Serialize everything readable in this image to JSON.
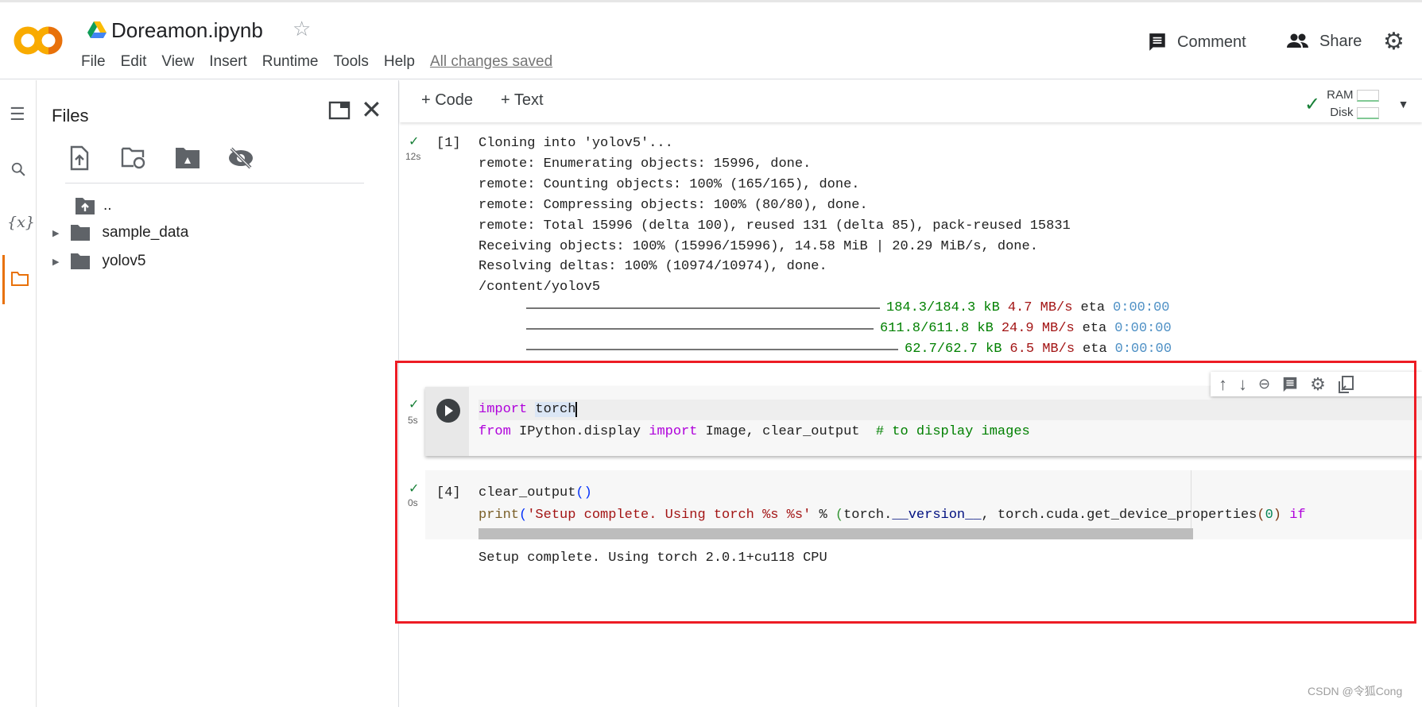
{
  "header": {
    "title": "Doreamon.ipynb",
    "menu": [
      "File",
      "Edit",
      "View",
      "Insert",
      "Runtime",
      "Tools",
      "Help"
    ],
    "saved": "All changes saved",
    "comment": "Comment",
    "share": "Share"
  },
  "toolbar": {
    "code": "+ Code",
    "text": "+ Text",
    "ram": "RAM",
    "disk": "Disk"
  },
  "files": {
    "title": "Files",
    "items": [
      {
        "name": "..",
        "type": "parent"
      },
      {
        "name": "sample_data",
        "type": "folder"
      },
      {
        "name": "yolov5",
        "type": "folder"
      }
    ]
  },
  "cells": [
    {
      "exec": "[1]",
      "time": "12s",
      "status": "success",
      "output": [
        "Cloning into 'yolov5'...",
        "remote: Enumerating objects: 15996, done.",
        "remote: Counting objects: 100% (165/165), done.",
        "remote: Compressing objects: 100% (80/80), done.",
        "remote: Total 15996 (delta 100), reused 131 (delta 85), pack-reused 15831",
        "Receiving objects: 100% (15996/15996), 14.58 MiB | 20.29 MiB/s, done.",
        "Resolving deltas: 100% (10974/10974), done.",
        "/content/yolov5"
      ],
      "progress": [
        {
          "size": "184.3/184.3 kB",
          "speed": "4.7 MB/s",
          "eta_label": "eta",
          "eta": "0:00:00"
        },
        {
          "size": "611.8/611.8 kB",
          "speed": "24.9 MB/s",
          "eta_label": "eta",
          "eta": "0:00:00"
        },
        {
          "size": "62.7/62.7 kB",
          "speed": "6.5 MB/s",
          "eta_label": "eta",
          "eta": "0:00:00"
        }
      ]
    },
    {
      "exec": "",
      "time": "5s",
      "status": "success",
      "code": [
        [
          {
            "t": "import",
            "c": "#af00db"
          },
          {
            "t": " "
          },
          {
            "t": "torch",
            "c": "#212121",
            "hl": true
          }
        ],
        [
          {
            "t": "from",
            "c": "#af00db"
          },
          {
            "t": " IPython.display "
          },
          {
            "t": "import",
            "c": "#af00db"
          },
          {
            "t": " Image, clear_output  "
          },
          {
            "t": "# to display images",
            "c": "#008000"
          }
        ]
      ]
    },
    {
      "exec": "[4]",
      "time": "0s",
      "status": "success",
      "code": [
        [
          {
            "t": "clear_output"
          },
          {
            "t": "()",
            "c": "#0431fa"
          }
        ],
        [
          {
            "t": "print",
            "c": "#795e26"
          },
          {
            "t": "(",
            "c": "#0431fa"
          },
          {
            "t": "'Setup complete. Using torch %s %s'",
            "c": "#a31515"
          },
          {
            "t": " % "
          },
          {
            "t": "(",
            "c": "#319331"
          },
          {
            "t": "torch."
          },
          {
            "t": "__version__",
            "c": "#001080"
          },
          {
            "t": ", torch.cuda.get_device_properties"
          },
          {
            "t": "(",
            "c": "#7b3814"
          },
          {
            "t": "0",
            "c": "#098658"
          },
          {
            "t": ")",
            "c": "#7b3814"
          },
          {
            "t": " "
          },
          {
            "t": "if",
            "c": "#af00db"
          }
        ]
      ],
      "output": "Setup complete. Using torch 2.0.1+cu118 CPU"
    }
  ],
  "watermark": "CSDN @令狐Cong",
  "colors": {
    "logo_orange": "#f9ab00",
    "logo_dark": "#e8710a",
    "highlight_box": "#ed1c24",
    "success": "#188038",
    "progress_size": "#008000",
    "progress_speed": "#a31515",
    "progress_eta": "#4e90c5"
  }
}
